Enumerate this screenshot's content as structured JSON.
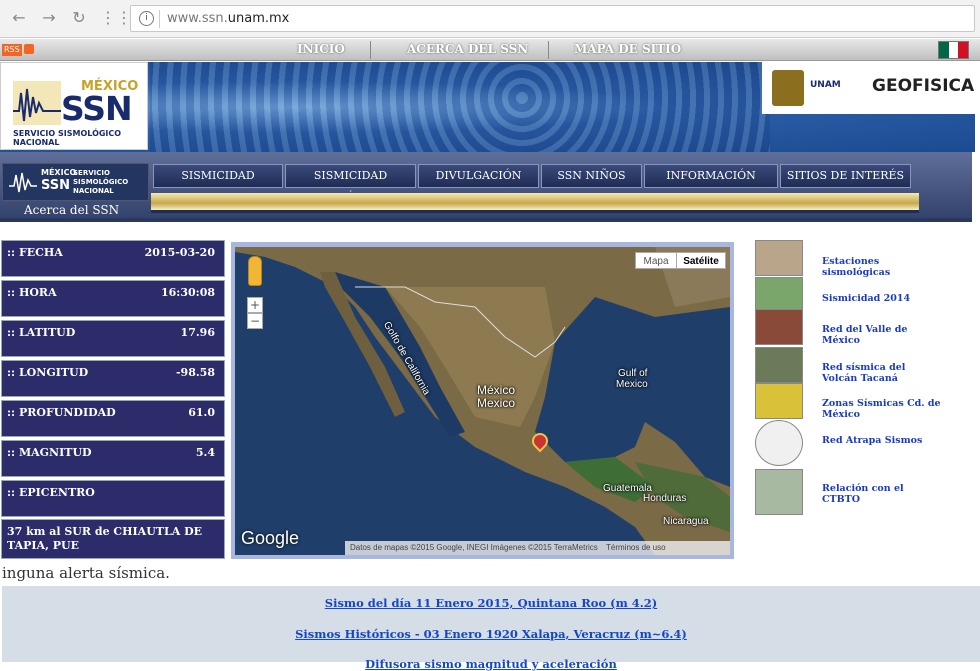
{
  "browser": {
    "back_icon": "arrow-left-icon",
    "forward_icon": "arrow-right-icon",
    "reload_icon": "reload-icon",
    "apps_icon": "apps-grid-icon",
    "url_prefix": "www.ssn.",
    "url_domain": "unam.mx"
  },
  "topbar": {
    "rss_label": "RSS",
    "links": [
      "INICIO",
      "ACERCA DEL SSN",
      "MAPA DE SITIO"
    ],
    "flag_colors": [
      "#006847",
      "#ffffff",
      "#ce1126"
    ]
  },
  "banner": {
    "logo_mexico": "MÉXICO",
    "logo_ssn": "SSN",
    "logo_sub": "SERVICIO SISMOLÓGICO NACIONAL",
    "partner_unam": "UNAM",
    "partner_geofisica": "GEOFISICA"
  },
  "nav": {
    "logo_mexico": "MÉXICO",
    "logo_ssn": "SSN",
    "logo_name": "SERVICIO SISMOLÓGICO NACIONAL",
    "items": [
      "SISMICIDAD RECIENTE",
      "SISMICIDAD HISTÓRICA",
      "DIVULGACIÓN",
      "SSN NIÑOS",
      "INFORMACIÓN GENERAL",
      "SITIOS DE INTERÉS"
    ],
    "breadcrumb": "Acerca del SSN"
  },
  "quake": {
    "rows": [
      {
        "label": ":: FECHA",
        "value": "2015-03-20"
      },
      {
        "label": ":: HORA",
        "value": "16:30:08"
      },
      {
        "label": ":: LATITUD",
        "value": "17.96"
      },
      {
        "label": ":: LONGITUD",
        "value": "-98.58"
      },
      {
        "label": ":: PROFUNDIDAD",
        "value": "61.0"
      },
      {
        "label": ":: MAGNITUD",
        "value": "5.4"
      },
      {
        "label": ":: EPICENTRO",
        "value": ""
      }
    ],
    "epicentro_text": "37 km al SUR de CHIAUTLA DE TAPIA, PUE"
  },
  "map": {
    "type_map": "Mapa",
    "type_satellite": "Satélite",
    "zoom_in": "+",
    "zoom_out": "−",
    "labels": {
      "gulf_california": "Golfo de California",
      "mexico_1": "México",
      "mexico_2": "Mexico",
      "gulf_mexico_1": "Gulf of",
      "gulf_mexico_2": "Mexico",
      "guatemala": "Guatemala",
      "honduras": "Honduras",
      "nicaragua": "Nicaragua"
    },
    "google": "Google",
    "attribution": "Datos de mapas ©2015 Google, INEGI Imágenes ©2015 TerraMetrics",
    "terms": "Términos de uso"
  },
  "sidebar": {
    "links": [
      {
        "text": "Estaciones sismológicas",
        "thumb_color": "#b9a58a"
      },
      {
        "text": "Sismicidad 2014",
        "thumb_color": "#7aa56b"
      },
      {
        "text": "Red del Valle de México",
        "thumb_color": "#8a4a3a"
      },
      {
        "text": "Red sísmica del Volcán Tacaná",
        "thumb_color": "#6b7b5a"
      },
      {
        "text": "Zonas Sísmicas Cd. de México",
        "thumb_color": "#d9c23a"
      },
      {
        "text": "Red Atrapa Sismos",
        "thumb_color": "#f0f0f0"
      },
      {
        "text": "Relación con el CTBTO",
        "thumb_color": "#a7b9a0"
      }
    ]
  },
  "alert": "inguna alerta sísmica.",
  "bottom_links": [
    "Sismo del día 11 Enero 2015, Quintana Roo (m 4.2)",
    "Sismos Históricos - 03 Enero 1920 Xalapa, Veracruz (m~6.4)",
    "Difusora sismo magnitud y aceleración"
  ]
}
